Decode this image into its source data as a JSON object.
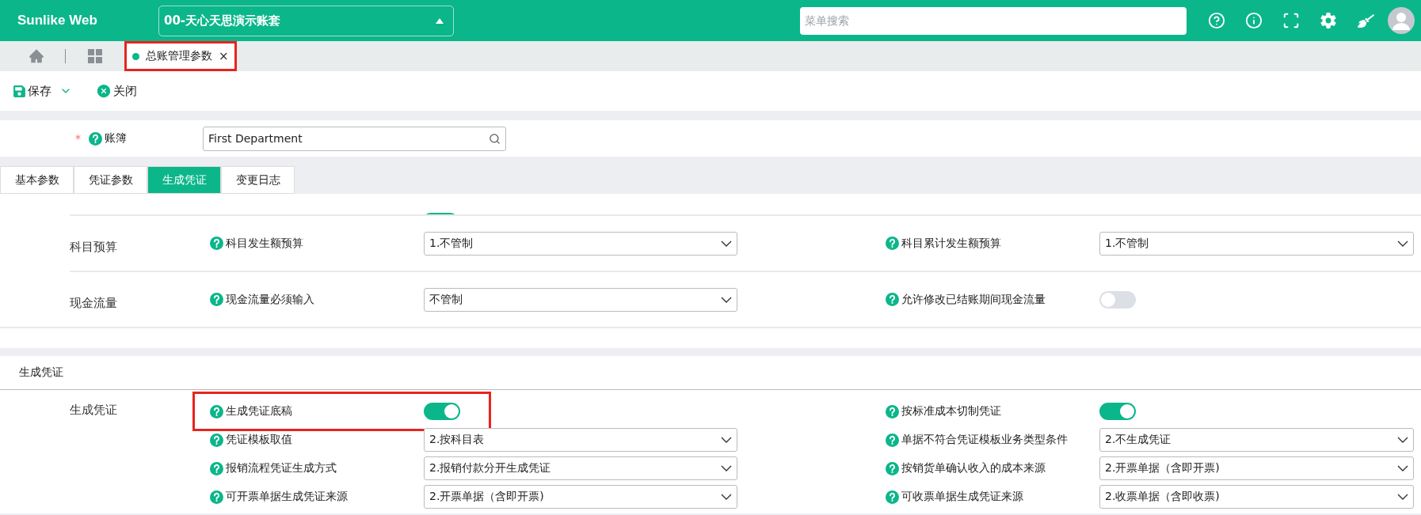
{
  "header": {
    "logo": "Sunlike Web",
    "account": "00-天心天思演示账套",
    "search": {
      "placeholder": "菜单搜索"
    }
  },
  "page_tabs": [
    {
      "label": "总账管理参数",
      "close": "×",
      "selected": true,
      "highlighted": true
    }
  ],
  "toolbar": [
    {
      "kind": "save",
      "label": "保存"
    },
    {
      "kind": "close",
      "label": "关闭"
    }
  ],
  "ledger": {
    "required_mark": "*",
    "label": "账簿",
    "value": "First Department"
  },
  "tabs": [
    {
      "label": "基本参数",
      "selected": false
    },
    {
      "label": "凭证参数",
      "selected": false
    },
    {
      "label": "生成凭证",
      "selected": true
    },
    {
      "label": "变更日志",
      "selected": false
    }
  ],
  "clipped_row": {
    "on": true
  },
  "groups": [
    {
      "label": "科目预算",
      "fields": [
        {
          "kind": "select",
          "label": "科目发生额预算",
          "value": "1.不管制",
          "highlighted": false
        },
        {
          "kind": "select",
          "label": "科目累计发生额预算",
          "value": "1.不管制",
          "highlighted": false
        }
      ]
    },
    {
      "label": "现金流量",
      "fields": [
        {
          "kind": "select",
          "label": "现金流量必须输入",
          "value": "不管制",
          "highlighted": false
        },
        {
          "kind": "toggle",
          "label": "允许修改已结账期间现金流量",
          "on": false,
          "highlighted": false
        }
      ]
    }
  ],
  "section": {
    "title": "生成凭证",
    "groups": [
      {
        "label": "生成凭证",
        "fields": [
          {
            "kind": "toggle",
            "label": "生成凭证底稿",
            "on": true,
            "highlighted": true
          },
          {
            "kind": "toggle",
            "label": "按标准成本切制凭证",
            "on": true,
            "highlighted": false
          },
          {
            "kind": "select",
            "label": "凭证模板取值",
            "value": "2.按科目表",
            "highlighted": false
          },
          {
            "kind": "select",
            "label": "单据不符合凭证模板业务类型条件",
            "value": "2.不生成凭证",
            "highlighted": false
          },
          {
            "kind": "select",
            "label": "报销流程凭证生成方式",
            "value": "2.报销付款分开生成凭证",
            "highlighted": false
          },
          {
            "kind": "select",
            "label": "按销货单确认收入的成本来源",
            "value": "2.开票单据（含即开票)",
            "highlighted": false
          },
          {
            "kind": "select",
            "label": "可开票单据生成凭证来源",
            "value": "2.开票单据（含即开票)",
            "highlighted": false
          },
          {
            "kind": "select",
            "label": "可收票单据生成凭证来源",
            "value": "2.收票单据（含即收票)",
            "highlighted": false
          }
        ]
      }
    ]
  }
}
